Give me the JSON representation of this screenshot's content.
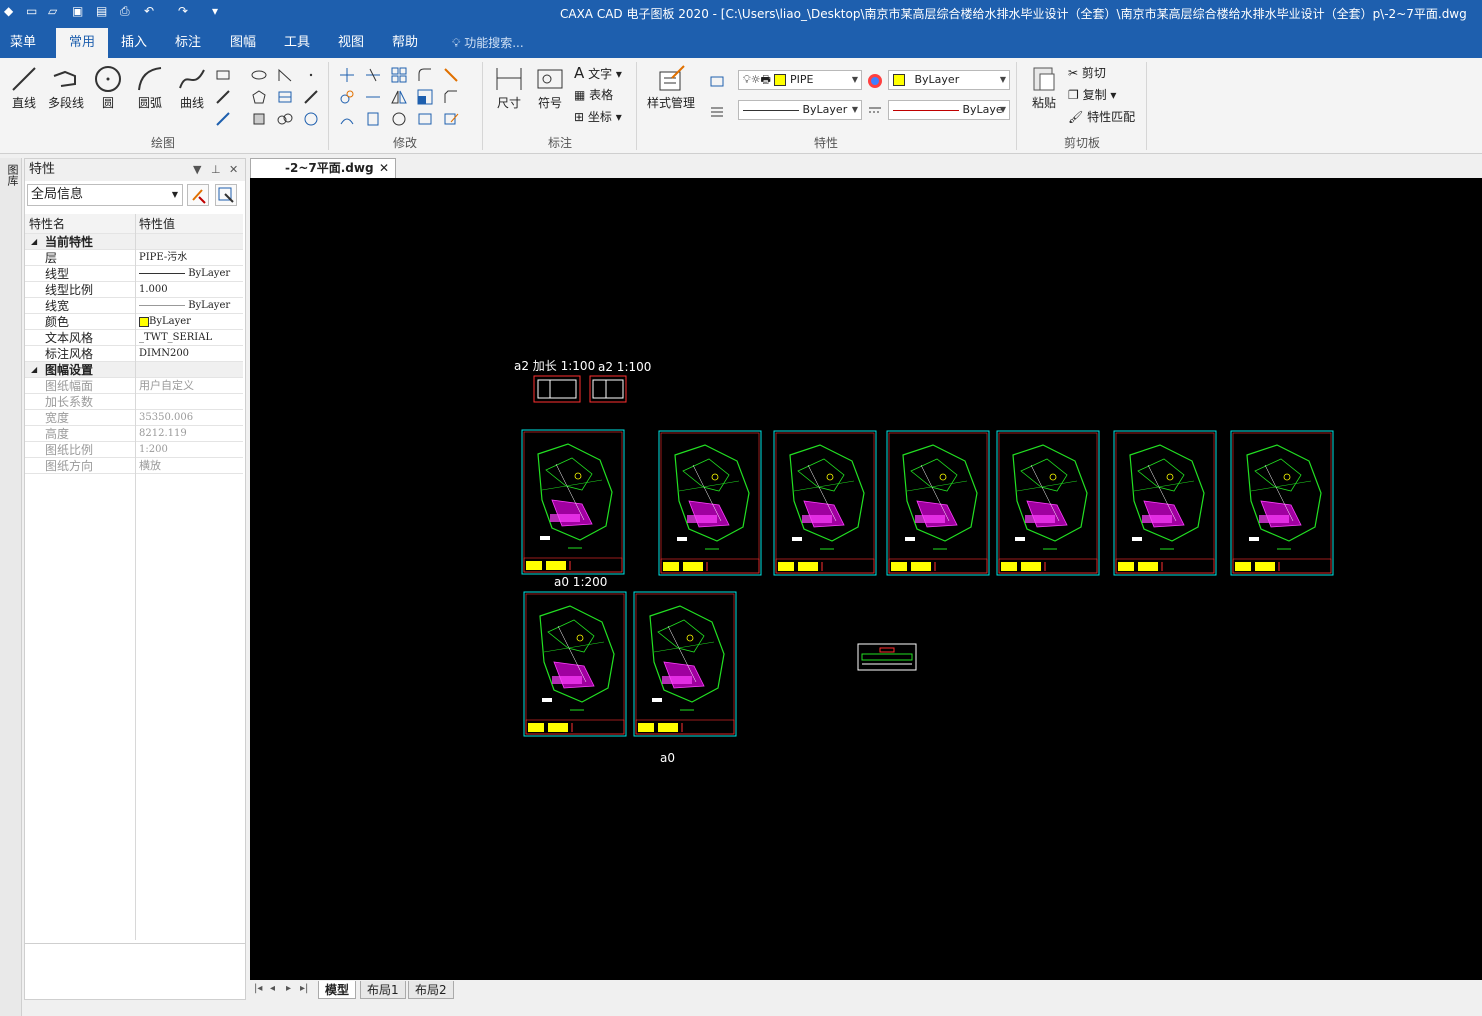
{
  "titlebar": {
    "title": "CAXA CAD 电子图板 2020 - [C:\\Users\\liao_\\Desktop\\南京市某高层综合楼给水排水毕业设计（全套）\\南京市某高层综合楼给水排水毕业设计（全套）p\\-2~7平面.dwg"
  },
  "menu": {
    "items": [
      "菜单",
      "常用",
      "插入",
      "标注",
      "图幅",
      "工具",
      "视图",
      "帮助"
    ],
    "active": "常用",
    "search_placeholder": "功能搜索..."
  },
  "ribbon": {
    "draw": {
      "line": "直线",
      "polyline": "多段线",
      "circle": "圆",
      "arc": "圆弧",
      "curve": "曲线",
      "group": "绘图"
    },
    "modify": {
      "group": "修改"
    },
    "annotate": {
      "dimension": "尺寸",
      "symbol": "符号",
      "text": "文字",
      "table": "表格",
      "coordinate": "坐标",
      "group": "标注"
    },
    "properties": {
      "style_manager": "样式管理",
      "layer": "PIPE",
      "color": "ByLayer",
      "linetype": "ByLayer",
      "lineweight": "ByLaye",
      "group": "特性"
    },
    "clipboard": {
      "paste": "粘贴",
      "cut": "剪切",
      "copy": "复制",
      "match": "特性匹配",
      "group": "剪切板"
    }
  },
  "sidestrip": {
    "label": "图库"
  },
  "panel": {
    "title": "特性",
    "combo": "全局信息",
    "col_name": "特性名",
    "col_value": "特性值",
    "section1": "当前特性",
    "rows1": [
      {
        "k": "层",
        "v": "PIPE-污水"
      },
      {
        "k": "线型",
        "v": "ByLayer"
      },
      {
        "k": "线型比例",
        "v": "1.000"
      },
      {
        "k": "线宽",
        "v": "ByLayer"
      },
      {
        "k": "颜色",
        "v": "ByLayer"
      },
      {
        "k": "文本风格",
        "v": "_TWT_SERIAL"
      },
      {
        "k": "标注风格",
        "v": "DIMN200"
      }
    ],
    "section2": "图幅设置",
    "rows2": [
      {
        "k": "图纸幅面",
        "v": "用户自定义"
      },
      {
        "k": "加长系数",
        "v": ""
      },
      {
        "k": "宽度",
        "v": "35350.006"
      },
      {
        "k": "高度",
        "v": "8212.119"
      },
      {
        "k": "图纸比例",
        "v": "1:200"
      },
      {
        "k": "图纸方向",
        "v": "横放"
      }
    ]
  },
  "document": {
    "tab": "-2~7平面.dwg",
    "layouts": [
      "模型",
      "布局1",
      "布局2"
    ],
    "labels": {
      "a2_ext": "a2 加长 1:100",
      "a2": "a2  1:100",
      "a0_scale": "a0  1:200",
      "a0": "a0"
    }
  },
  "colors": {
    "accent": "#1e5fae",
    "canvas": "#000000",
    "frame": "#00e5e5",
    "plan_green": "#22e022",
    "magenta": "#ff40ff",
    "yellow": "#ffff00"
  }
}
